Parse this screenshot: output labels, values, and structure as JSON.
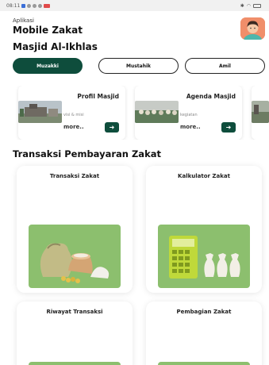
{
  "status_bar": {
    "time": "08:11"
  },
  "header": {
    "subtitle": "Aplikasi",
    "title": "Mobile Zakat",
    "masjid_name": "Masjid Al-Ikhlas"
  },
  "tabs": [
    {
      "label": "Muzakki",
      "active": true
    },
    {
      "label": "Mustahik",
      "active": false
    },
    {
      "label": "Amil",
      "active": false
    }
  ],
  "menu_cards": [
    {
      "title": "Profil Masjid",
      "subtitle": "visi & misi",
      "more": "more..",
      "button_icon": "arrow-right-icon"
    },
    {
      "title": "Agenda Masjid",
      "subtitle": "kegiatan",
      "more": "more..",
      "button_icon": "arrow-right-icon"
    }
  ],
  "section": {
    "title": "Transaksi Pembayaran Zakat"
  },
  "features": [
    {
      "title": "Transaksi Zakat",
      "icon": "zakat-sacks-icon"
    },
    {
      "title": "Kalkulator Zakat",
      "icon": "calculator-icon"
    },
    {
      "title": "Riwayat Transaksi",
      "icon": "history-icon"
    },
    {
      "title": "Pembagian Zakat",
      "icon": "distribution-icon"
    }
  ],
  "colors": {
    "primary": "#0e4d3c",
    "accent_green": "#8cbf6e",
    "avatar_bg": "#f08e6a"
  }
}
